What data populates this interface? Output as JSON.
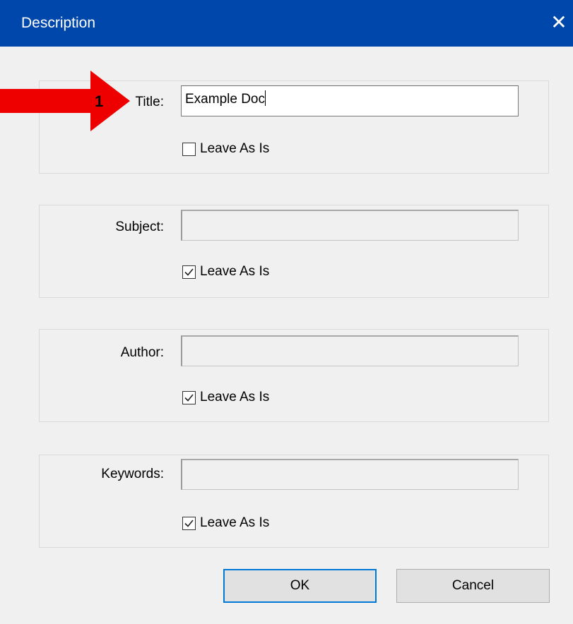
{
  "window": {
    "title": "Description",
    "close_icon": "close-icon"
  },
  "annotation": {
    "number": "1",
    "arrow_color": "#ee0000"
  },
  "fields": [
    {
      "label": "Title:",
      "value": "Example Doc",
      "enabled": true,
      "leave_as_is_label": "Leave As Is",
      "leave_as_is_checked": false
    },
    {
      "label": "Subject:",
      "value": "",
      "enabled": false,
      "leave_as_is_label": "Leave As Is",
      "leave_as_is_checked": true
    },
    {
      "label": "Author:",
      "value": "",
      "enabled": false,
      "leave_as_is_label": "Leave As Is",
      "leave_as_is_checked": true
    },
    {
      "label": "Keywords:",
      "value": "",
      "enabled": false,
      "leave_as_is_label": "Leave As Is",
      "leave_as_is_checked": true
    }
  ],
  "buttons": {
    "ok_label": "OK",
    "cancel_label": "Cancel"
  },
  "colors": {
    "titlebar": "#0047ab",
    "focus_border": "#0078d7"
  }
}
